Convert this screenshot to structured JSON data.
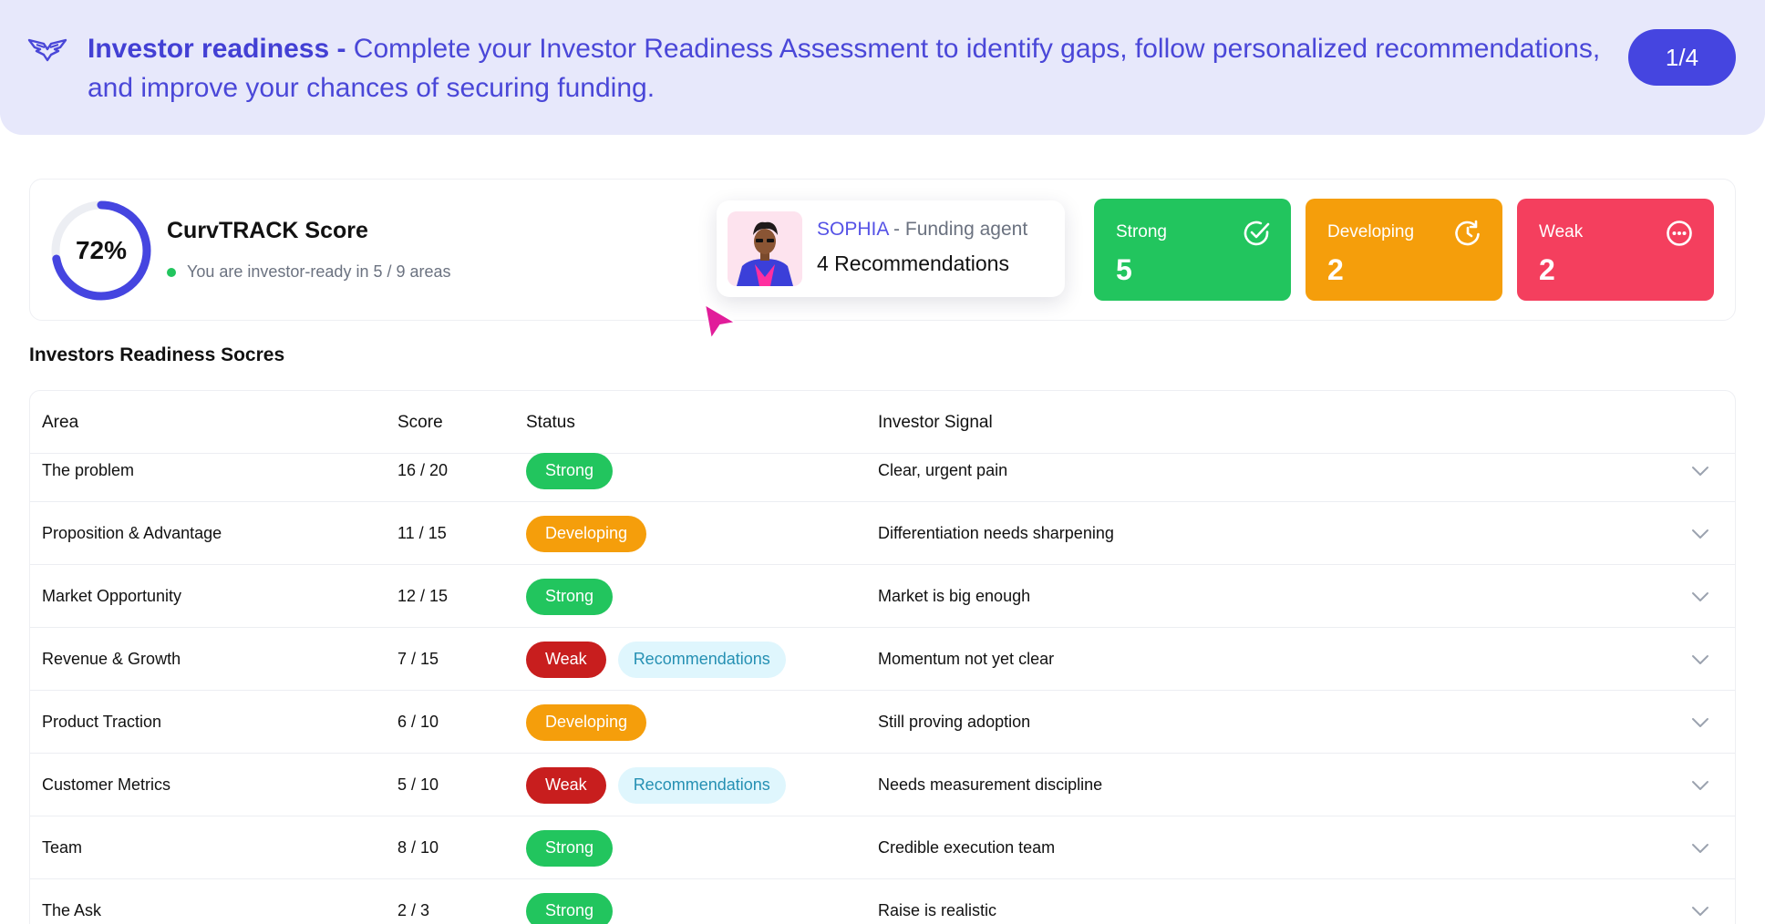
{
  "banner": {
    "title": "Investor readiness",
    "separator": " - ",
    "message": "Complete your Investor Readiness Assessment to identify gaps, follow personalized recommendations, and improve your chances of securing funding.",
    "step": "1/4",
    "icon": "wings-icon"
  },
  "summary": {
    "score_percent": "72%",
    "score_fraction": 0.72,
    "score_title": "CurvTRACK Score",
    "score_sub": "You are investor-ready in 5 / 9 areas"
  },
  "agent": {
    "name": "SOPHIA",
    "dash": " - ",
    "role": "Funding agent",
    "recommendations": "4 Recommendations"
  },
  "stats": [
    {
      "label": "Strong",
      "value": "5",
      "icon": "check-circle-icon",
      "color": "#22c55e"
    },
    {
      "label": "Developing",
      "value": "2",
      "icon": "clock-refresh-icon",
      "color": "#f59e0b"
    },
    {
      "label": "Weak",
      "value": "2",
      "icon": "dots-circle-icon",
      "color": "#f43f5e"
    }
  ],
  "table": {
    "title": "Investors Readiness Socres",
    "headers": {
      "area": "Area",
      "score": "Score",
      "status": "Status",
      "signal": "Investor Signal"
    },
    "rows": [
      {
        "area": "The problem",
        "score": "16 / 20",
        "status": "Strong",
        "signal": "Clear, urgent pain"
      },
      {
        "area": "Proposition & Advantage",
        "score": "11 / 15",
        "status": "Developing",
        "signal": "Differentiation needs sharpening"
      },
      {
        "area": "Market Opportunity",
        "score": "12 / 15",
        "status": "Strong",
        "signal": "Market is big enough"
      },
      {
        "area": "Revenue & Growth",
        "score": "7 / 15",
        "status": "Weak",
        "recommendation": "Recommendations",
        "signal": "Momentum not yet clear"
      },
      {
        "area": "Product Traction",
        "score": "6 / 10",
        "status": "Developing",
        "signal": "Still proving adoption"
      },
      {
        "area": "Customer Metrics",
        "score": "5 / 10",
        "status": "Weak",
        "recommendation": "Recommendations",
        "signal": "Needs measurement discipline"
      },
      {
        "area": "Team",
        "score": "8 / 10",
        "status": "Strong",
        "signal": "Credible execution team"
      },
      {
        "area": "The Ask",
        "score": "2 / 3",
        "status": "Strong",
        "signal": "Raise is realistic"
      }
    ]
  },
  "colors": {
    "accent": "#4545e0",
    "strong": "#22c55e",
    "developing": "#f59e0b",
    "weak_pill": "#c81e1e",
    "weak_card": "#f43f5e",
    "recommendation_bg": "#dff6fd",
    "pointer": "#e11d9a"
  }
}
